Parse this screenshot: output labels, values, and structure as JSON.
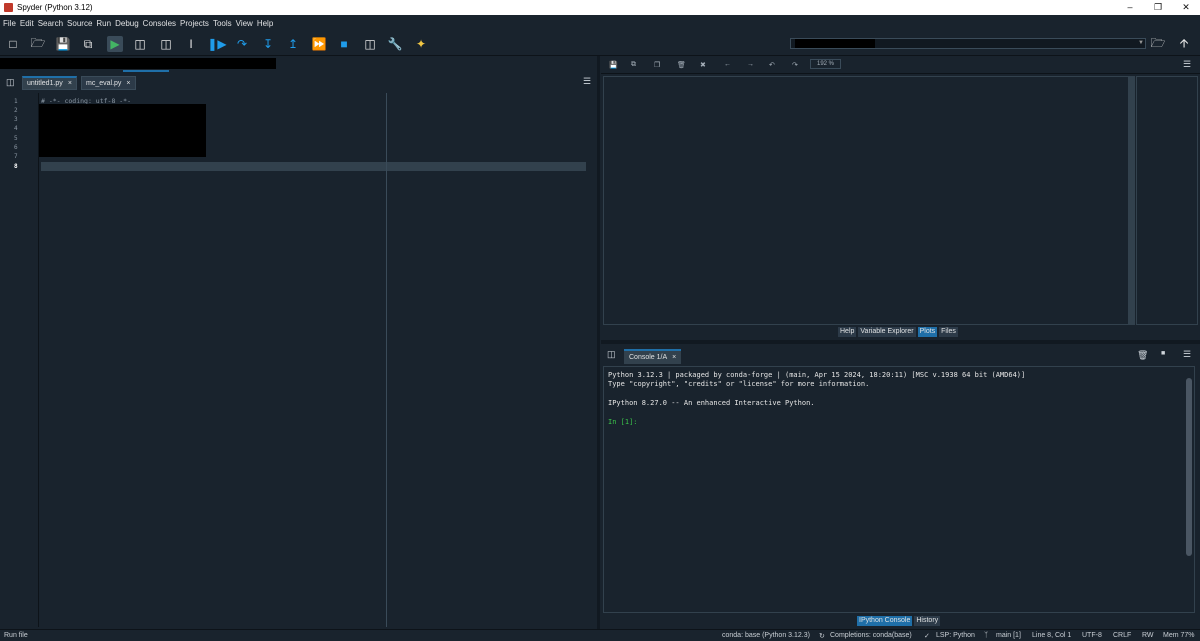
{
  "window": {
    "title": "Spyder (Python 3.12)",
    "controls": [
      "–",
      "❐",
      "✕"
    ]
  },
  "menu": [
    "File",
    "Edit",
    "Search",
    "Source",
    "Run",
    "Debug",
    "Consoles",
    "Projects",
    "Tools",
    "View",
    "Help"
  ],
  "toolbar": {
    "icons": [
      "new-file-icon",
      "open-file-icon",
      "save-icon",
      "save-all-icon",
      "run-icon",
      "run-cell-icon",
      "run-cell-advance-icon",
      "run-selection-icon",
      "debug-file-icon",
      "debug-step-over-icon",
      "debug-step-into-icon",
      "debug-step-return-icon",
      "debug-continue-icon",
      "debug-stop-icon",
      "maximize-pane-icon",
      "preferences-icon",
      "python-path-icon"
    ],
    "right_icons": [
      "browse-folder-icon",
      "parent-folder-icon"
    ]
  },
  "editor": {
    "tabs": [
      {
        "label": "untitled1.py",
        "close": "×"
      },
      {
        "label": "mc_eval.py",
        "close": "×"
      }
    ],
    "line_numbers": [
      "1",
      "2",
      "3",
      "4",
      "5",
      "6",
      "7",
      "8"
    ],
    "current_line": "8",
    "lines": [
      "# -*- coding: utf-8 -*-"
    ]
  },
  "plots": {
    "zoom": "192 %",
    "tabs": [
      "Help",
      "Variable Explorer",
      "Plots",
      "Files"
    ],
    "active_tab": "Plots"
  },
  "console": {
    "tab_label": "Console 1/A",
    "tab_close": "×",
    "lines": [
      "Python 3.12.3 | packaged by conda-forge | (main, Apr 15 2024, 18:20:11) [MSC v.1938 64 bit (AMD64)]",
      "Type \"copyright\", \"credits\" or \"license\" for more information.",
      "",
      "IPython 8.27.0 -- An enhanced Interactive Python.",
      "",
      "In [1]:"
    ],
    "bottom_tabs": [
      "IPython Console",
      "History"
    ],
    "active_tab": "IPython Console"
  },
  "status": {
    "left": "Run file",
    "env": "conda: base (Python 3.12.3)",
    "completions": "Completions: conda(base)",
    "lsp": "LSP: Python",
    "git": "main [1]",
    "position": "Line 8, Col 1",
    "encoding": "UTF-8",
    "eol": "CRLF",
    "permissions": "RW",
    "memory": "Mem 77%"
  }
}
